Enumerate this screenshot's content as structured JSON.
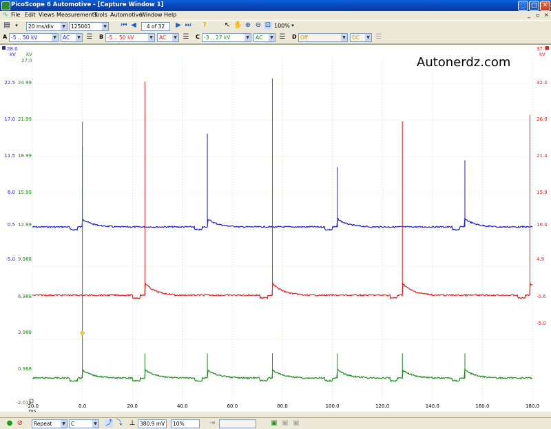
{
  "window": {
    "title": "PicoScope 6 Automotive - [Capture Window 1]",
    "min": "_",
    "max": "□",
    "close": "✕"
  },
  "menu": [
    "File",
    "Edit",
    "Views",
    "Measurements",
    "Tools",
    "Automotive",
    "Window",
    "Help"
  ],
  "toolbar": {
    "timebase": "20 ms/div",
    "samples": "125001",
    "capture_index": "4 of 32",
    "zoom": "100%"
  },
  "channels": [
    {
      "letter": "A",
      "range": "-5 .. 50 kV",
      "coupling": "AC",
      "color": "#1f1fd0"
    },
    {
      "letter": "B",
      "range": "-5 .. 50 kV",
      "coupling": "AC",
      "color": "#e02020"
    },
    {
      "letter": "C",
      "range": "-3 .. 27 kV",
      "coupling": "AC",
      "color": "#1c8c1c"
    },
    {
      "letter": "D",
      "range": "Off",
      "coupling": "DC",
      "color": "#c8a000"
    }
  ],
  "watermark": "Autonerdz.com",
  "axes": {
    "a_unit": "kV",
    "a_top": "28.0",
    "c_unit": "kV",
    "c_top": "27.0",
    "b_unit": "kV",
    "b_top": "37.9",
    "x_unit": "ms",
    "a_ticks": [
      "22.5",
      "17.0",
      "11.5",
      "6.0",
      "0.5",
      "-5.0"
    ],
    "c_ticks": [
      "24.99",
      "21.99",
      "18.99",
      "15.99",
      "12.99",
      "9.988",
      "6.988",
      "3.988",
      "0.988",
      "-2.012"
    ],
    "b_ticks": [
      "32.4",
      "26.9",
      "21.4",
      "15.9",
      "10.4",
      "4.9",
      "-0.6",
      "-5.0"
    ],
    "x_ticks": [
      "-20.0",
      "0.0",
      "20.0",
      "40.0",
      "60.0",
      "80.0",
      "100.0",
      "120.0",
      "140.0",
      "160.0",
      "180.0"
    ]
  },
  "chart_data": {
    "type": "line",
    "x_range_ms": [
      -20,
      180
    ],
    "series": [
      {
        "name": "A",
        "color": "#1f1fd0",
        "baseline_kV": 0.5,
        "spikes": [
          {
            "x": 0,
            "kV": 12.5
          },
          {
            "x": 50,
            "kV": 14.5
          },
          {
            "x": 102,
            "kV": 9.5
          },
          {
            "x": 153,
            "kV": 10.5
          }
        ]
      },
      {
        "name": "B",
        "color": "#e02020",
        "baseline_kV": -0.6,
        "spikes": [
          {
            "x": 25,
            "kV": 31.5
          },
          {
            "x": 76,
            "kV": 32.0
          },
          {
            "x": 128,
            "kV": 25.5
          },
          {
            "x": 179,
            "kV": 26.5
          }
        ]
      },
      {
        "name": "C",
        "color": "#1c8c1c",
        "baseline_kV": 0.988,
        "spikes": [
          {
            "x": 0,
            "kV": 22.0
          },
          {
            "x": 25,
            "kV": 3.0
          },
          {
            "x": 50,
            "kV": 3.0
          },
          {
            "x": 76,
            "kV": 3.0
          },
          {
            "x": 102,
            "kV": 3.0
          },
          {
            "x": 128,
            "kV": 3.0
          },
          {
            "x": 153,
            "kV": 3.0
          }
        ]
      }
    ]
  },
  "statusbar": {
    "trigger_mode": "Repeat",
    "trigger_channel": "C",
    "trigger_level": "380.9 mV",
    "pre_trigger": "10%"
  }
}
